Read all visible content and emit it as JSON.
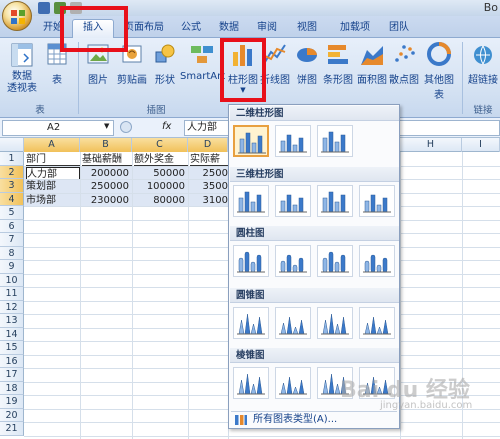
{
  "title_bar": {
    "title": "Bo"
  },
  "tabs": [
    {
      "label": "开始"
    },
    {
      "label": "插入"
    },
    {
      "label": "页面布局"
    },
    {
      "label": "公式"
    },
    {
      "label": "数据"
    },
    {
      "label": "审阅"
    },
    {
      "label": "视图"
    },
    {
      "label": "加载项"
    },
    {
      "label": "团队"
    }
  ],
  "ribbon": {
    "pivot_label": "数据\n透视表",
    "table_label": "表",
    "picture_label": "图片",
    "clipart_label": "剪贴画",
    "shapes_label": "形状",
    "smartart_label": "SmartArt",
    "column_label": "柱形图",
    "line_label": "折线图",
    "pie_label": "饼图",
    "bar_label": "条形图",
    "area_label": "面积图",
    "scatter_label": "散点图",
    "other_label": "其他图表",
    "hyperlink_label": "超链接",
    "group_table": "表",
    "group_illustrations": "插图",
    "group_links": "链接"
  },
  "formula_bar": {
    "name_box": "A2",
    "fx": "fx",
    "content": "人力部"
  },
  "columns": [
    "A",
    "B",
    "C",
    "D",
    "H",
    "I"
  ],
  "rows": [
    "1",
    "2",
    "3",
    "4",
    "5",
    "6",
    "7",
    "8",
    "9",
    "10",
    "11",
    "12",
    "13",
    "14",
    "15",
    "16",
    "17",
    "18",
    "19",
    "20",
    "21"
  ],
  "sheet": {
    "headers": [
      "部门",
      "基础薪酬",
      "额外奖金",
      "实际薪"
    ],
    "data": [
      [
        "人力部",
        "200000",
        "50000",
        "2500"
      ],
      [
        "策划部",
        "250000",
        "100000",
        "3500"
      ],
      [
        "市场部",
        "230000",
        "80000",
        "3100"
      ]
    ]
  },
  "dropdown": {
    "sections": [
      {
        "title": "二维柱形图"
      },
      {
        "title": "三维柱形图"
      },
      {
        "title": "圆柱图"
      },
      {
        "title": "圆锥图"
      },
      {
        "title": "棱锥图"
      }
    ],
    "all_types": "所有图表类型(A)..."
  },
  "watermark": {
    "main": "Bai du 经验",
    "sub": "jingyan.baidu.com"
  },
  "colors": {
    "highlight": "#e8101a",
    "ribbon_text": "#15428b",
    "selected": "#f1c15a"
  }
}
